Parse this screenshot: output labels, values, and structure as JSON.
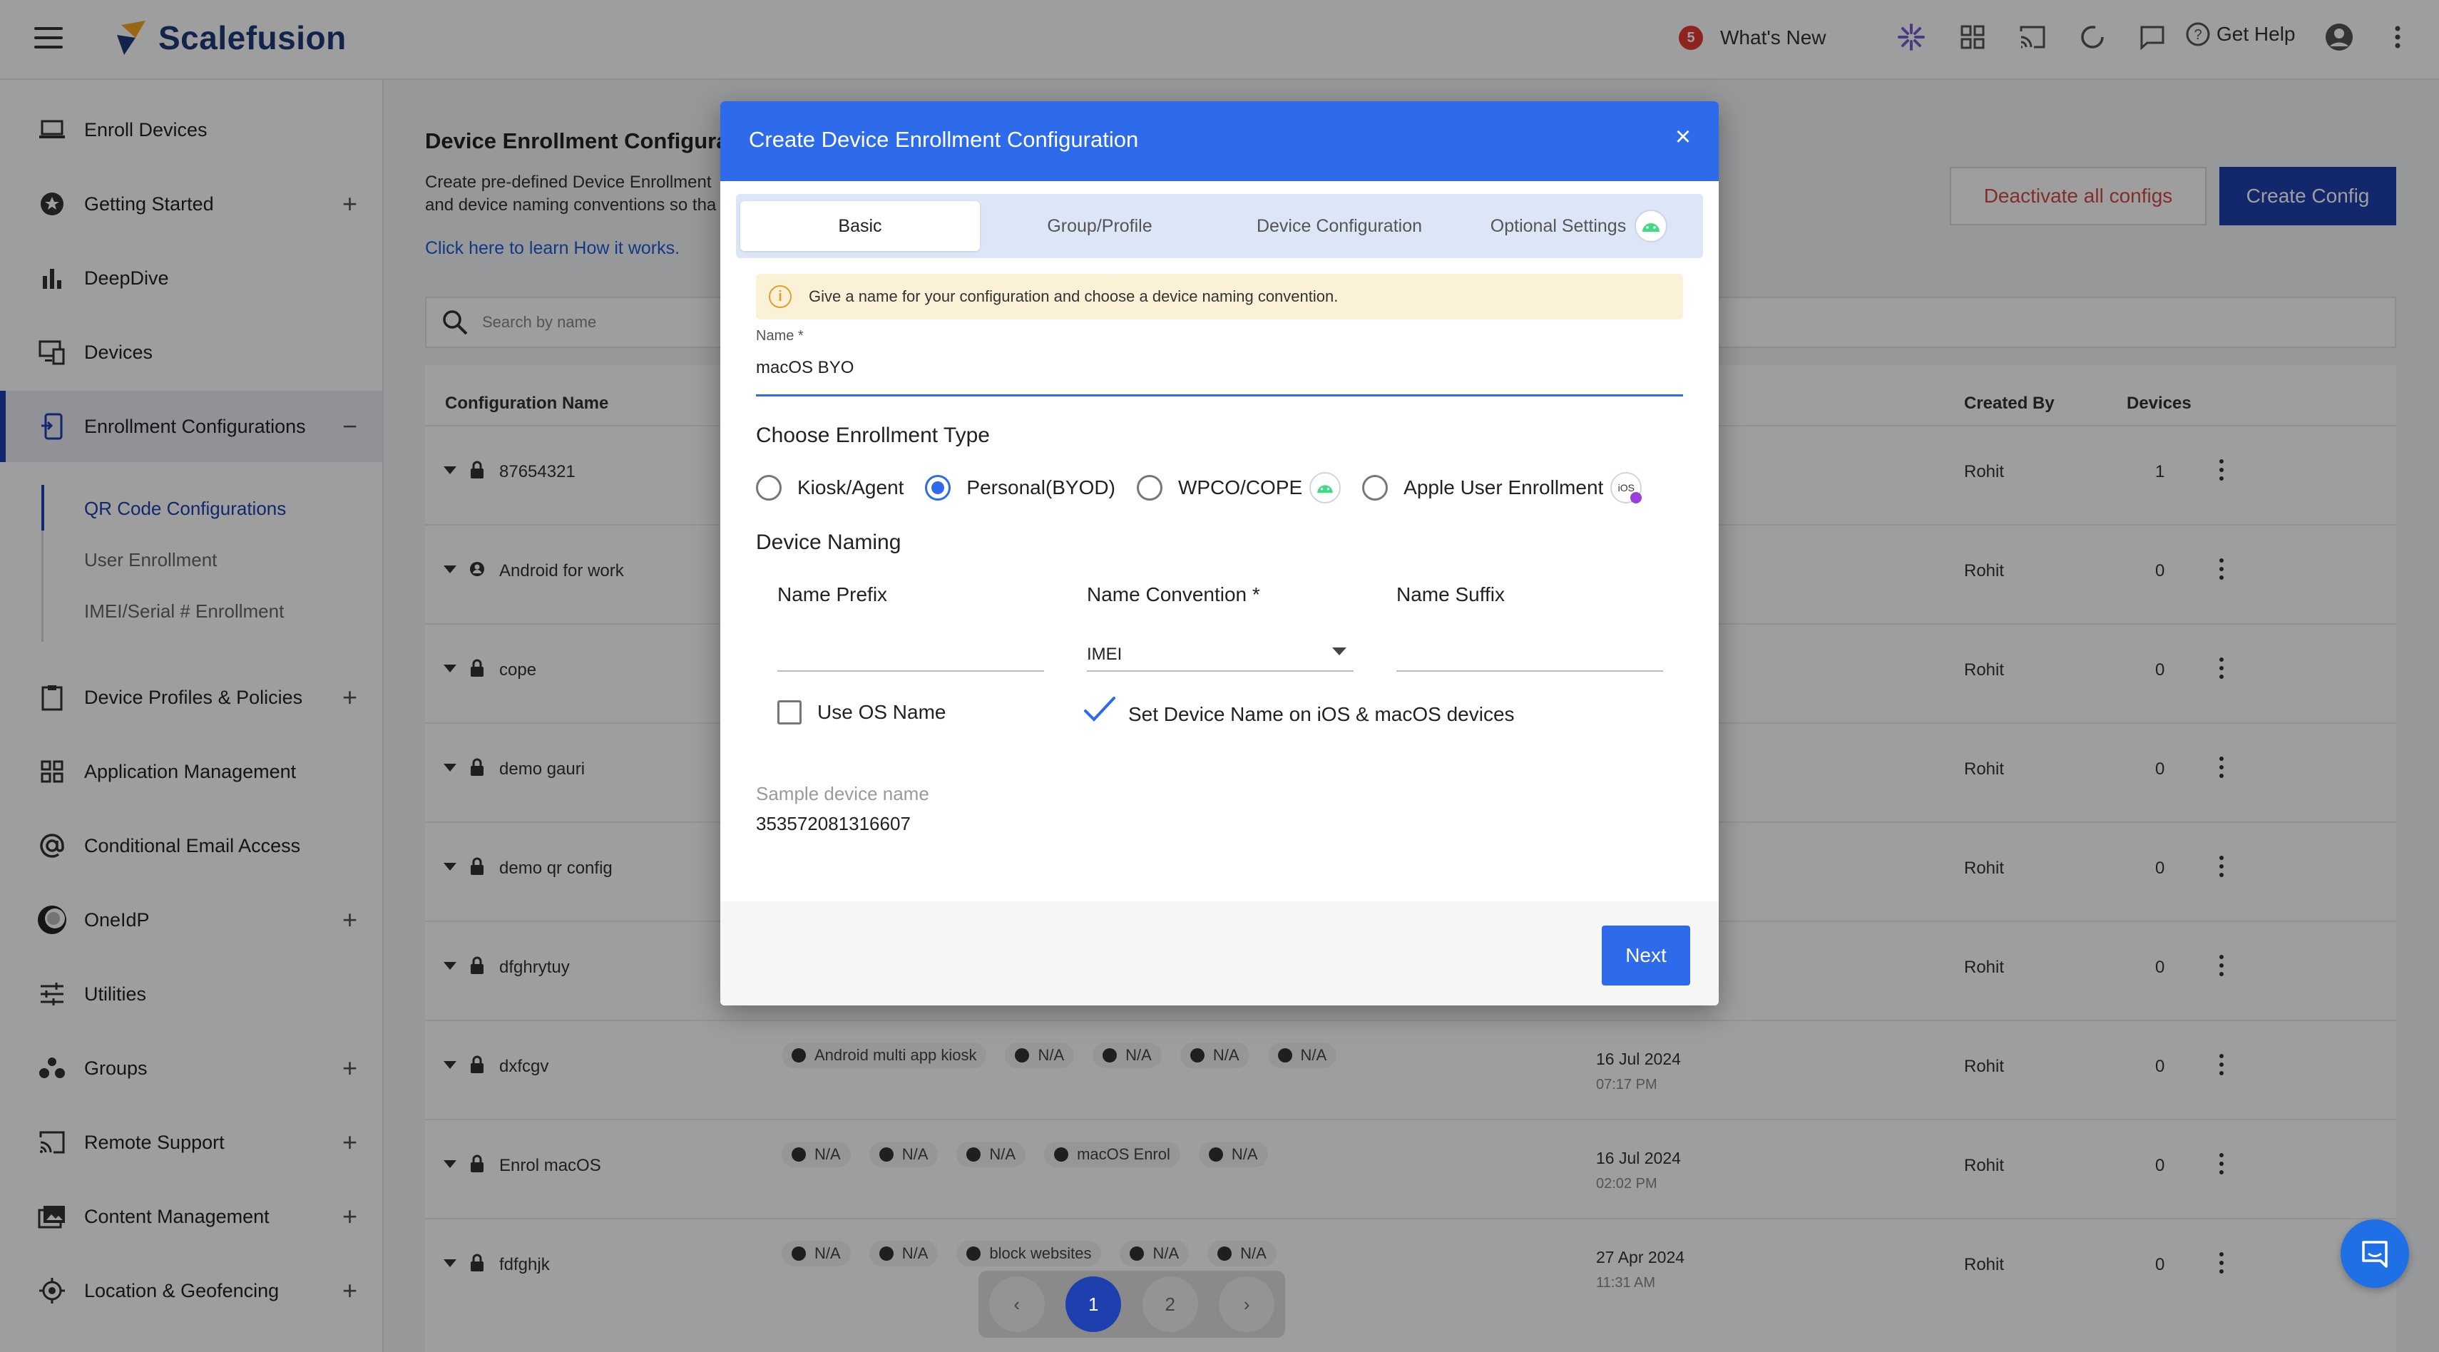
{
  "app": {
    "name": "Scalefusion",
    "whats_new_count": "5",
    "whats_new_label": "What's New",
    "get_help_label": "Get Help",
    "brand_color": "#1e40af"
  },
  "sidebar": {
    "items": [
      {
        "label": "Enroll Devices",
        "icon": "laptop-icon",
        "plus": ""
      },
      {
        "label": "Getting Started",
        "icon": "star-badge-icon",
        "plus": "+"
      },
      {
        "label": "DeepDive",
        "icon": "bar-chart-icon",
        "plus": ""
      },
      {
        "label": "Devices",
        "icon": "devices-icon",
        "plus": ""
      },
      {
        "label": "Enrollment Configurations",
        "icon": "enrollment-icon",
        "plus": "−"
      },
      {
        "label": "Device Profiles & Policies",
        "icon": "clipboard-icon",
        "plus": "+"
      },
      {
        "label": "Application Management",
        "icon": "grid-icon",
        "plus": ""
      },
      {
        "label": "Conditional Email Access",
        "icon": "at-sign-icon",
        "plus": ""
      },
      {
        "label": "OneIdP",
        "icon": "oneidp-icon",
        "plus": "+"
      },
      {
        "label": "Utilities",
        "icon": "sliders-icon",
        "plus": ""
      },
      {
        "label": "Groups",
        "icon": "groups-icon",
        "plus": "+"
      },
      {
        "label": "Remote Support",
        "icon": "cast-icon",
        "plus": "+"
      },
      {
        "label": "Content Management",
        "icon": "images-icon",
        "plus": "+"
      },
      {
        "label": "Location & Geofencing",
        "icon": "target-icon",
        "plus": "+"
      }
    ],
    "subitems": [
      {
        "label": "QR Code Configurations"
      },
      {
        "label": "User Enrollment"
      },
      {
        "label": "IMEI/Serial # Enrollment"
      }
    ]
  },
  "main": {
    "title": "Device Enrollment Configura",
    "desc_line1": "Create pre-defined Device Enrollment",
    "desc_line2": "and device naming conventions so tha",
    "learn_link": "Click here to learn How it works.",
    "deactivate_label": "Deactivate all configs",
    "create_label": "Create Config",
    "search_placeholder": "Search by name",
    "columns": {
      "name": "Configuration Name",
      "created_by": "Created By",
      "devices": "Devices"
    },
    "rows": [
      {
        "name": "87654321",
        "lock": "lock",
        "tags": [],
        "date": "",
        "time": "",
        "created_by": "Rohit",
        "devices": "1"
      },
      {
        "name": "Android for work",
        "lock": "person",
        "tags": [],
        "date": "",
        "time": "",
        "created_by": "Rohit",
        "devices": "0"
      },
      {
        "name": "cope",
        "lock": "lock",
        "tags": [],
        "date": "",
        "time": "",
        "created_by": "Rohit",
        "devices": "0"
      },
      {
        "name": "demo gauri",
        "lock": "lock",
        "tags": [],
        "date": "",
        "time": "",
        "created_by": "Rohit",
        "devices": "0"
      },
      {
        "name": "demo qr config",
        "lock": "lock",
        "tags": [],
        "date": "",
        "time": "",
        "created_by": "Rohit",
        "devices": "0"
      },
      {
        "name": "dfghrytuy",
        "lock": "lock",
        "tags": [],
        "date": "",
        "time": "",
        "created_by": "Rohit",
        "devices": "0"
      },
      {
        "name": "dxfcgv",
        "lock": "lock",
        "tags": [
          "Android multi app kiosk",
          "N/A",
          "N/A",
          "N/A",
          "N/A"
        ],
        "date": "16 Jul 2024",
        "time": "07:17 PM",
        "created_by": "Rohit",
        "devices": "0"
      },
      {
        "name": "Enrol macOS",
        "lock": "lock",
        "tags": [
          "N/A",
          "N/A",
          "N/A",
          "macOS Enrol",
          "N/A"
        ],
        "date": "16 Jul 2024",
        "time": "02:02 PM",
        "created_by": "Rohit",
        "devices": "0"
      },
      {
        "name": "fdfghjk",
        "lock": "lock",
        "tags": [
          "N/A",
          "N/A",
          "block websites",
          "N/A",
          "N/A"
        ],
        "date": "27 Apr 2024",
        "time": "11:31 AM",
        "created_by": "Rohit",
        "devices": "0"
      }
    ]
  },
  "pagination": {
    "prev": "‹",
    "pages": [
      "1",
      "2"
    ],
    "next": "›",
    "current": "1"
  },
  "modal": {
    "title": "Create Device Enrollment Configuration",
    "close": "×",
    "tabs": [
      {
        "label": "Basic"
      },
      {
        "label": "Group/Profile"
      },
      {
        "label": "Device Configuration"
      },
      {
        "label": "Optional Settings"
      }
    ],
    "info": "Give a name for your configuration and choose a device naming convention.",
    "name_label": "Name *",
    "name_value": "macOS BYO",
    "enrollment_heading": "Choose Enrollment Type",
    "enrollment_types": [
      {
        "label": "Kiosk/Agent",
        "selected": false
      },
      {
        "label": "Personal(BYOD)",
        "selected": true
      },
      {
        "label": "WPCO/COPE",
        "selected": false
      },
      {
        "label": "Apple User Enrollment",
        "selected": false
      }
    ],
    "ios_badge": "iOS",
    "naming_heading": "Device Naming",
    "name_prefix_label": "Name Prefix",
    "name_prefix_value": "",
    "name_convention_label": "Name Convention *",
    "name_convention_value": "IMEI",
    "name_suffix_label": "Name Suffix",
    "name_suffix_value": "",
    "use_os_name_label": "Use OS Name",
    "use_os_name_checked": false,
    "set_device_name_label": "Set Device Name on iOS & macOS devices",
    "set_device_name_checked": true,
    "sample_label": "Sample device name",
    "sample_value": "353572081316607",
    "next_label": "Next"
  }
}
